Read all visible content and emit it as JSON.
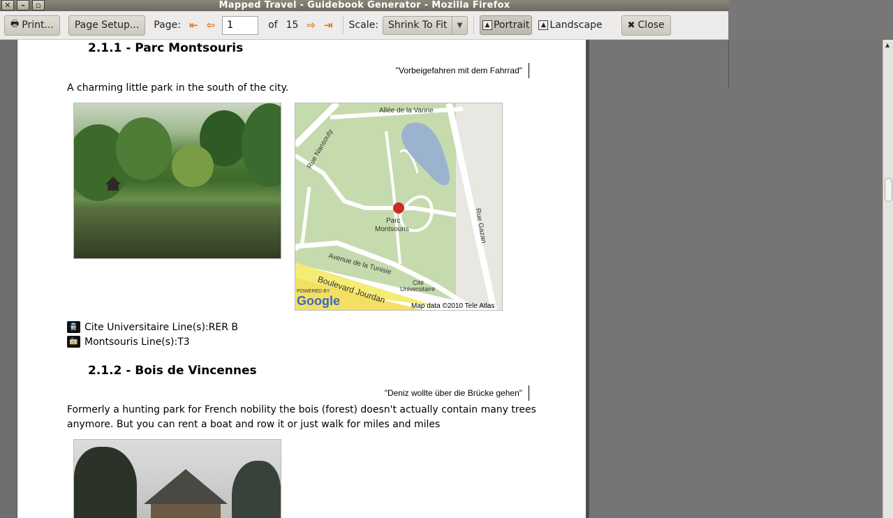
{
  "window": {
    "title": "Mapped Travel - Guidebook Generator - Mozilla Firefox"
  },
  "toolbar": {
    "print_label": "Print...",
    "page_setup_label": "Page Setup...",
    "page_label": "Page:",
    "page_value": "1",
    "of_label": "of",
    "total_pages": "15",
    "scale_label": "Scale:",
    "scale_value": "Shrink To Fit",
    "portrait_label": "Portrait",
    "landscape_label": "Landscape",
    "close_label": "Close"
  },
  "page": {
    "section1": {
      "heading": "2.1.1 - Parc Montsouris",
      "quote": "\"Vorbeigefahren mit dem Fahrrad\"",
      "description": "A charming little park in the south of the city.",
      "map_labels": {
        "place": "Parc",
        "place2": "Montsouris",
        "road1": "Boulevard Jourdan",
        "road2": "Rue Nansouty",
        "road3": "Rue Gazan",
        "road4": "Allée de la Vanne",
        "road5": "Avenue de la Tunisie",
        "station": "Cité",
        "station2": "Universitaire",
        "powered": "POWERED BY",
        "google": "Google",
        "mapdata": "Map data ©2010 Tele Atlas"
      },
      "transit": [
        {
          "icon": "train-icon",
          "text": "Cite Universitaire Line(s):RER B"
        },
        {
          "icon": "tram-icon",
          "text": "Montsouris Line(s):T3"
        }
      ]
    },
    "section2": {
      "heading": "2.1.2 - Bois de Vincennes",
      "quote": "\"Deniz wollte über die Brücke gehen\"",
      "description": "Formerly a hunting park for French nobility the bois (forest) doesn't actually contain many trees anymore. But you can rent a boat and row it or just walk for miles and miles"
    }
  }
}
